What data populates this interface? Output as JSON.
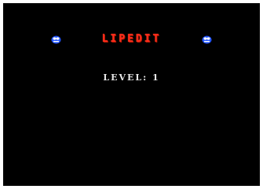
{
  "game": {
    "title": "LIPEDIT",
    "level_text": "LEVEL:  1"
  },
  "icons": {
    "left": "blue-ball-mascot",
    "right": "blue-ball-mascot"
  },
  "colors": {
    "background": "#000000",
    "frame": "#ffffff",
    "title": "#ff2a1a",
    "level_text": "#e8e8e8",
    "mascot": "#2255ff"
  }
}
